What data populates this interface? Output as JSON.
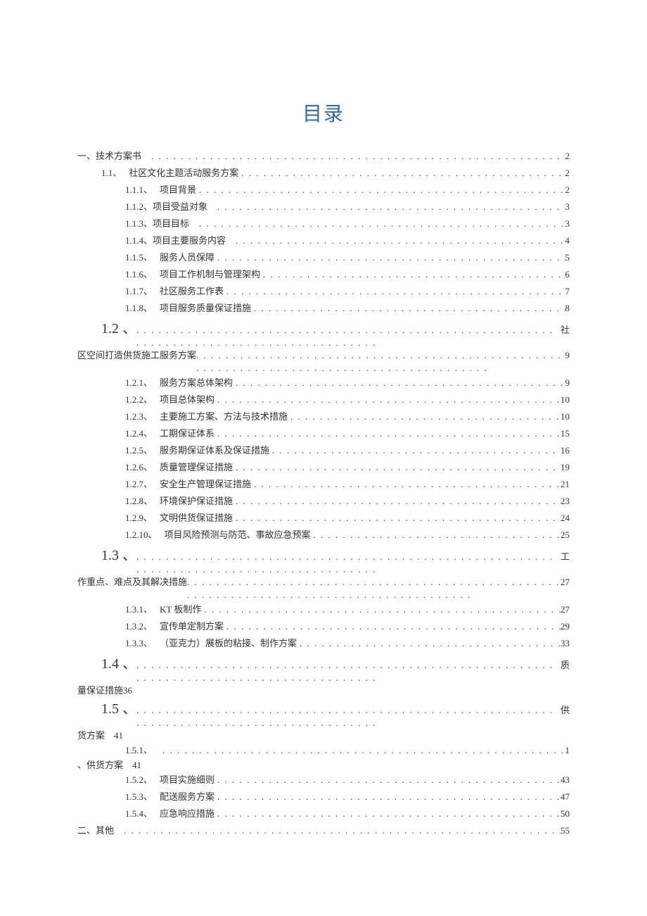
{
  "title": "目录",
  "lines": [
    {
      "type": "simple",
      "level": 0,
      "num": "一、技术方案书",
      "label": "",
      "page": "2"
    },
    {
      "type": "simple",
      "level": 1,
      "num": "1.1、",
      "label": "社区文化主题活动服务方案",
      "page": "2"
    },
    {
      "type": "simple",
      "level": 2,
      "num": "1.1.1、",
      "label": "项目背景",
      "page": "2"
    },
    {
      "type": "simple",
      "level": 2,
      "num": "1.1.2、项目受益对象",
      "label": "",
      "page": "3"
    },
    {
      "type": "simple",
      "level": 2,
      "num": "1.1.3、项目目标",
      "label": "",
      "page": "3"
    },
    {
      "type": "simple",
      "level": 2,
      "num": "1.1.4、项目主要服务内容",
      "label": "",
      "page": "4"
    },
    {
      "type": "simple",
      "level": 2,
      "num": "1.1.5、",
      "label": "服务人员保障",
      "page": "5"
    },
    {
      "type": "simple",
      "level": 2,
      "num": "1.1.6、",
      "label": "项目工作机制与管理架构",
      "page": "6"
    },
    {
      "type": "simple",
      "level": 2,
      "num": "1.1.7、",
      "label": "社区服务工作表",
      "page": "7"
    },
    {
      "type": "simple",
      "level": 2,
      "num": "1.1.8、",
      "label": "项目服务质量保证措施",
      "page": "8"
    },
    {
      "type": "big",
      "bignum": "1.2 、",
      "trail": "社",
      "wrapLabel": "区空间打造供货施工服务方案",
      "wrapPage": "9"
    },
    {
      "type": "simple",
      "level": 2,
      "num": "1.2.1、",
      "label": "服务方案总体架构",
      "page": "9"
    },
    {
      "type": "simple",
      "level": 2,
      "num": "1.2.2、",
      "label": "项目总体架构",
      "page": "10"
    },
    {
      "type": "simple",
      "level": 2,
      "num": "1.2.3、",
      "label": "主要施工方案、方法与技术措施",
      "page": "10"
    },
    {
      "type": "simple",
      "level": 2,
      "num": "1.2.4、",
      "label": "工期保证体系",
      "page": "15"
    },
    {
      "type": "simple",
      "level": 2,
      "num": "1.2.5、",
      "label": "服务期保证体系及保证措施",
      "page": "16"
    },
    {
      "type": "simple",
      "level": 2,
      "num": "1.2.6、",
      "label": "质量管理保证措施",
      "page": "19"
    },
    {
      "type": "simple",
      "level": 2,
      "num": "1.2.7、",
      "label": "安全生产管理保证措施",
      "page": "21"
    },
    {
      "type": "simple",
      "level": 2,
      "num": "1.2.8、",
      "label": "环境保护保证措施",
      "page": "23"
    },
    {
      "type": "simple",
      "level": 2,
      "num": "1.2.9、",
      "label": "文明供货保证措施",
      "page": "24"
    },
    {
      "type": "simple",
      "level": 2,
      "num": "1.2.10、",
      "label": "项目风险预测与防范、事故应急预案",
      "page": "25"
    },
    {
      "type": "big",
      "bignum": "1.3 、",
      "trail": "工",
      "wrapLabel": "作重点、难点及其解决措施",
      "wrapPage": "27"
    },
    {
      "type": "simple",
      "level": 2,
      "num": "1.3.1、",
      "label": "KT 板制作",
      "page": "27"
    },
    {
      "type": "simple",
      "level": 2,
      "num": "1.3.2、",
      "label": "宣传单定制方案",
      "page": "29"
    },
    {
      "type": "simple",
      "level": 2,
      "num": "1.3.3、",
      "label": "（亚克力）展板的粘接、制作方案",
      "page": "33"
    },
    {
      "type": "big",
      "bignum": "1.4 、",
      "trail": "质",
      "wrapLabel": "量保证措施36",
      "wrapPage": ""
    },
    {
      "type": "big",
      "bignum": "1.5 、",
      "trail": "供",
      "wrapLabel": "货方案    41",
      "wrapPage": ""
    },
    {
      "type": "simple-wrap",
      "level": 2,
      "num": "1.5.1、",
      "trail": "1",
      "wrapLabel": "、供货方案    41",
      "wrapPage": ""
    },
    {
      "type": "simple",
      "level": 2,
      "num": "1.5.2、",
      "label": "项目实施细则",
      "page": "43"
    },
    {
      "type": "simple",
      "level": 2,
      "num": "1.5.3、",
      "label": "配送服务方案",
      "page": "47"
    },
    {
      "type": "simple",
      "level": 2,
      "num": "1.5.4、",
      "label": "应急响应措施",
      "page": "50"
    },
    {
      "type": "simple",
      "level": 0,
      "num": "二、其他",
      "label": "",
      "page": "55"
    }
  ]
}
